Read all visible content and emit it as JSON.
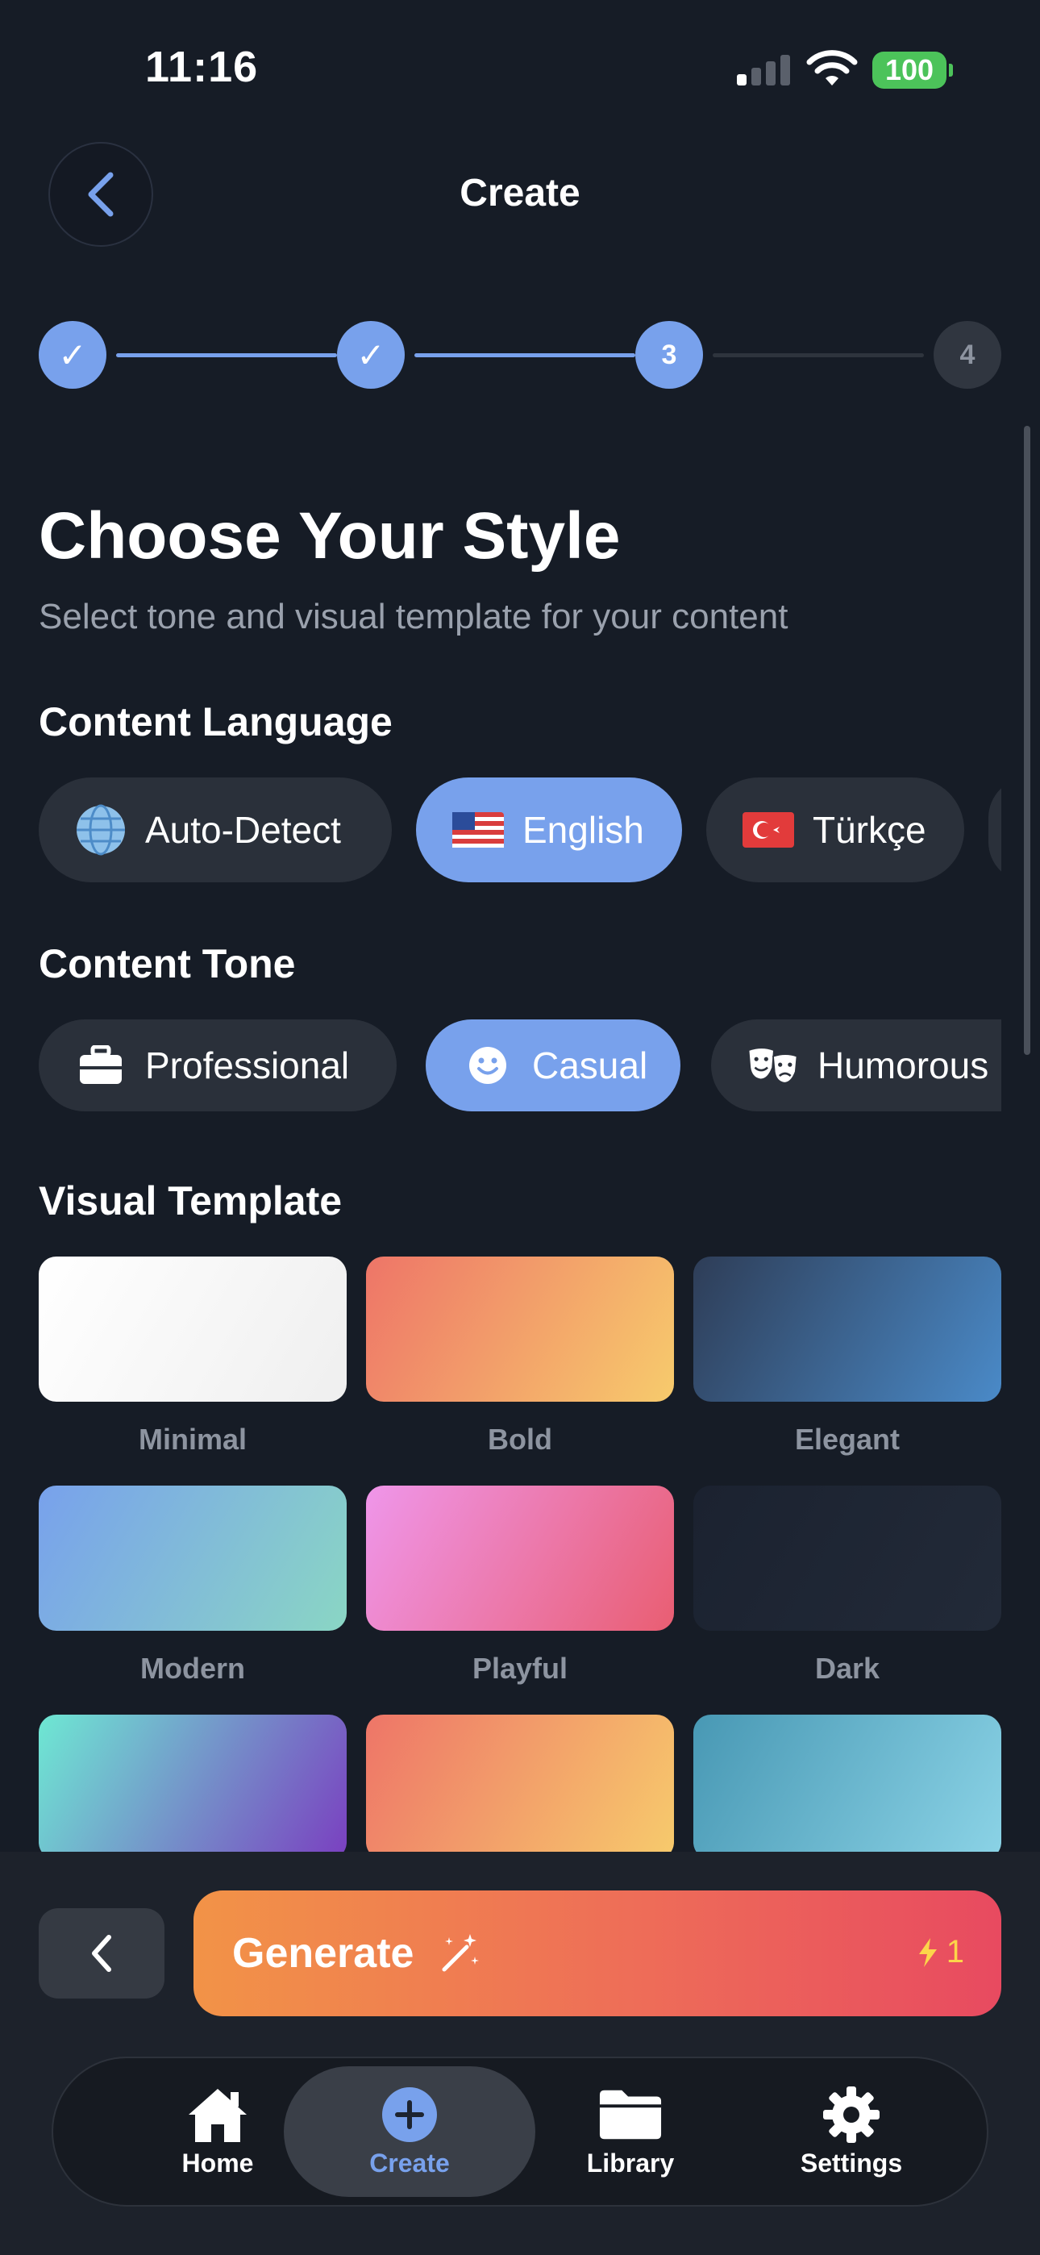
{
  "status_bar": {
    "time": "11:16",
    "battery": "100"
  },
  "header": {
    "title": "Create"
  },
  "stepper": {
    "steps": [
      "✓",
      "✓",
      "3",
      "4"
    ],
    "current": 3,
    "total": 4
  },
  "page": {
    "title": "Choose Your Style",
    "subtitle": "Select tone and visual template for your content"
  },
  "language": {
    "label": "Content Language",
    "options": [
      {
        "label": "Auto-Detect",
        "icon": "globe-icon",
        "selected": false
      },
      {
        "label": "English",
        "icon": "us-flag-icon",
        "selected": true
      },
      {
        "label": "Türkçe",
        "icon": "turkey-flag-icon",
        "selected": false
      }
    ]
  },
  "tone": {
    "label": "Content Tone",
    "options": [
      {
        "label": "Professional",
        "icon": "briefcase-icon",
        "selected": false
      },
      {
        "label": "Casual",
        "icon": "smiley-icon",
        "selected": true
      },
      {
        "label": "Humorous",
        "icon": "theater-masks-icon",
        "selected": false
      }
    ]
  },
  "templates": {
    "label": "Visual Template",
    "items": [
      {
        "label": "Minimal",
        "colors": [
          "#ffffff",
          "#efefef"
        ]
      },
      {
        "label": "Bold",
        "colors": [
          "#ee7568",
          "#f7cb6c"
        ]
      },
      {
        "label": "Elegant",
        "colors": [
          "#2e3d57",
          "#4a8ac8"
        ]
      },
      {
        "label": "Modern",
        "colors": [
          "#78a1ec",
          "#8ad6c4"
        ]
      },
      {
        "label": "Playful",
        "colors": [
          "#ef96ea",
          "#e95e72"
        ]
      },
      {
        "label": "Dark",
        "colors": [
          "#1b2230",
          "#222a38"
        ]
      },
      {
        "label": "",
        "colors": [
          "#6ee8d3",
          "#7a3fc0"
        ]
      },
      {
        "label": "",
        "colors": [
          "#ee7568",
          "#f7cb6c"
        ]
      },
      {
        "label": "",
        "colors": [
          "#4898b4",
          "#8bd3e6"
        ]
      }
    ]
  },
  "actions": {
    "generate_label": "Generate",
    "credit_cost": "1"
  },
  "tabs": [
    {
      "label": "Home",
      "icon": "home-icon",
      "active": false
    },
    {
      "label": "Create",
      "icon": "plus-circle-icon",
      "active": true
    },
    {
      "label": "Library",
      "icon": "folder-icon",
      "active": false
    },
    {
      "label": "Settings",
      "icon": "gear-icon",
      "active": false
    }
  ],
  "colors": {
    "background": "#161c26",
    "accent": "#78a1ec",
    "chip": "#2a303a",
    "generate_start": "#f29347",
    "generate_end": "#e84a60"
  }
}
